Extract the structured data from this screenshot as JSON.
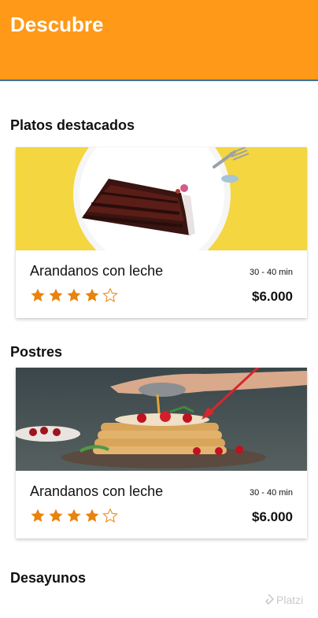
{
  "header": {
    "title": "Descubre",
    "bg_color": "#ff9917"
  },
  "sections": [
    {
      "title": "Platos destacados",
      "card": {
        "image": "chocolate-cake-image",
        "name": "Arandanos con leche",
        "time": "30 - 40 min",
        "price": "$6.000",
        "rating": 4,
        "rating_max": 5
      }
    },
    {
      "title": "Postres",
      "card": {
        "image": "pancakes-image",
        "name": "Arandanos con leche",
        "time": "30 - 40 min",
        "price": "$6.000",
        "rating": 4,
        "rating_max": 5
      }
    },
    {
      "title": "Desayunos"
    }
  ],
  "watermark": {
    "text": "Platzi"
  },
  "colors": {
    "accent": "#ff9917",
    "star": "#e8830c"
  }
}
